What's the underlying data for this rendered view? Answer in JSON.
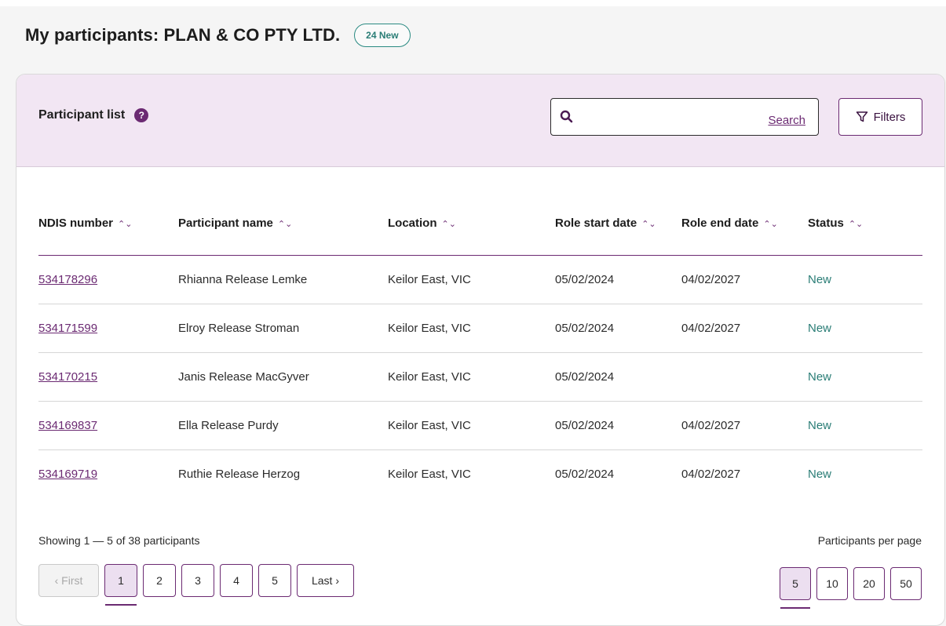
{
  "header": {
    "title": "My participants: PLAN & CO PTY LTD.",
    "new_badge": "24 New"
  },
  "list": {
    "title": "Participant list",
    "help_glyph": "?",
    "search_placeholder": "",
    "search_link": "Search",
    "filters_label": "Filters"
  },
  "table": {
    "columns": [
      "NDIS number",
      "Participant name",
      "Location",
      "Role start date",
      "Role end date",
      "Status"
    ],
    "sort_glyph": "⌃⌄",
    "rows": [
      {
        "ndis": "534178296",
        "name": "Rhianna Release Lemke",
        "location": "Keilor East, VIC",
        "start": "05/02/2024",
        "end": "04/02/2027",
        "status": "New"
      },
      {
        "ndis": "534171599",
        "name": "Elroy Release Stroman",
        "location": "Keilor East, VIC",
        "start": "05/02/2024",
        "end": "04/02/2027",
        "status": "New"
      },
      {
        "ndis": "534170215",
        "name": "Janis Release MacGyver",
        "location": "Keilor East, VIC",
        "start": "05/02/2024",
        "end": "",
        "status": "New"
      },
      {
        "ndis": "534169837",
        "name": "Ella Release Purdy",
        "location": "Keilor East, VIC",
        "start": "05/02/2024",
        "end": "04/02/2027",
        "status": "New"
      },
      {
        "ndis": "534169719",
        "name": "Ruthie Release Herzog",
        "location": "Keilor East, VIC",
        "start": "05/02/2024",
        "end": "04/02/2027",
        "status": "New"
      }
    ]
  },
  "footer": {
    "showing": "Showing 1 — 5 of 38 participants",
    "per_page_label": "Participants per page",
    "first": "‹ First",
    "pages": [
      "1",
      "2",
      "3",
      "4",
      "5"
    ],
    "last": "Last ›",
    "per_page_options": [
      "5",
      "10",
      "20",
      "50"
    ]
  },
  "colors": {
    "accent": "#6b2a72",
    "header_bg": "#f2e6f3",
    "status_new": "#2a7d76"
  }
}
